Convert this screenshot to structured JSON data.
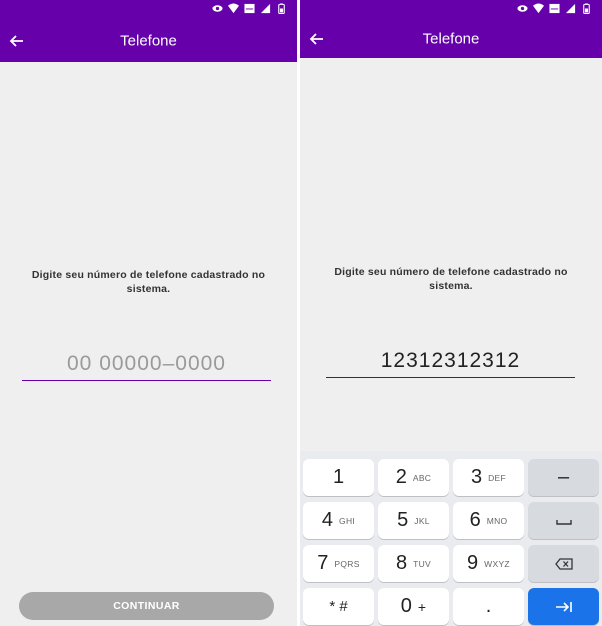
{
  "app": {
    "title": "Telefone"
  },
  "prompt": "Digite seu número de telefone cadastrado no sistema.",
  "phone_field": {
    "placeholder": "00 00000–0000",
    "value": "12312312312"
  },
  "continue_label": "CONTINUAR",
  "colors": {
    "primary": "#6600aa",
    "background": "#efefef",
    "button_disabled": "#a8a8a8",
    "enter_key": "#1a73e8"
  },
  "status_icons": [
    "eye-icon",
    "wifi-icon",
    "lte-icon",
    "signal-icon",
    "battery-icon"
  ],
  "keyboard": {
    "keys": [
      {
        "main": "1",
        "sub": ""
      },
      {
        "main": "2",
        "sub": "ABC"
      },
      {
        "main": "3",
        "sub": "DEF"
      },
      {
        "main": "–",
        "sub": ""
      },
      {
        "main": "4",
        "sub": "GHI"
      },
      {
        "main": "5",
        "sub": "JKL"
      },
      {
        "main": "6",
        "sub": "MNO"
      },
      {
        "main": "7",
        "sub": "PQRS"
      },
      {
        "main": "8",
        "sub": "TUV"
      },
      {
        "main": "9",
        "sub": "WXYZ"
      },
      {
        "main": "* #",
        "sub": ""
      },
      {
        "main": "0",
        "sub": "+"
      },
      {
        "main": ".",
        "sub": ""
      }
    ]
  }
}
